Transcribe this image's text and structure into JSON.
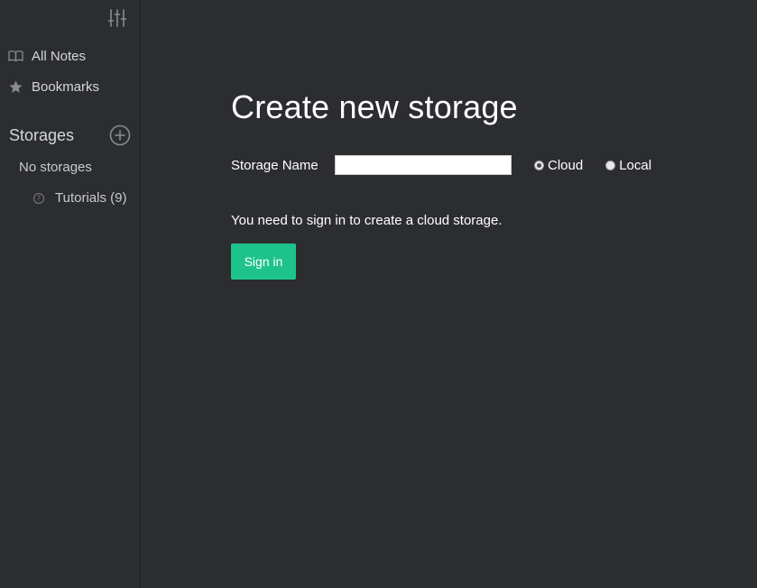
{
  "sidebar": {
    "preferences_icon": "sliders-icon",
    "nav": [
      {
        "label": "All Notes",
        "icon": "book-icon"
      },
      {
        "label": "Bookmarks",
        "icon": "star-icon"
      }
    ],
    "storages_title": "Storages",
    "add_storage_icon": "plus-circle-icon",
    "no_storages_label": "No storages",
    "tutorials_label": "Tutorials (9)"
  },
  "main": {
    "title": "Create new storage",
    "storage_name_label": "Storage Name",
    "storage_name_value": "",
    "storage_type": {
      "options": [
        "Cloud",
        "Local"
      ],
      "selected": "Cloud"
    },
    "signin_message": "You need to sign in to create a cloud storage.",
    "signin_button": "Sign in"
  },
  "colors": {
    "background": "#2c2d30",
    "accent": "#1ec38b",
    "muted_text": "#d6d7d8",
    "icon_gray": "#8a8b8d"
  }
}
